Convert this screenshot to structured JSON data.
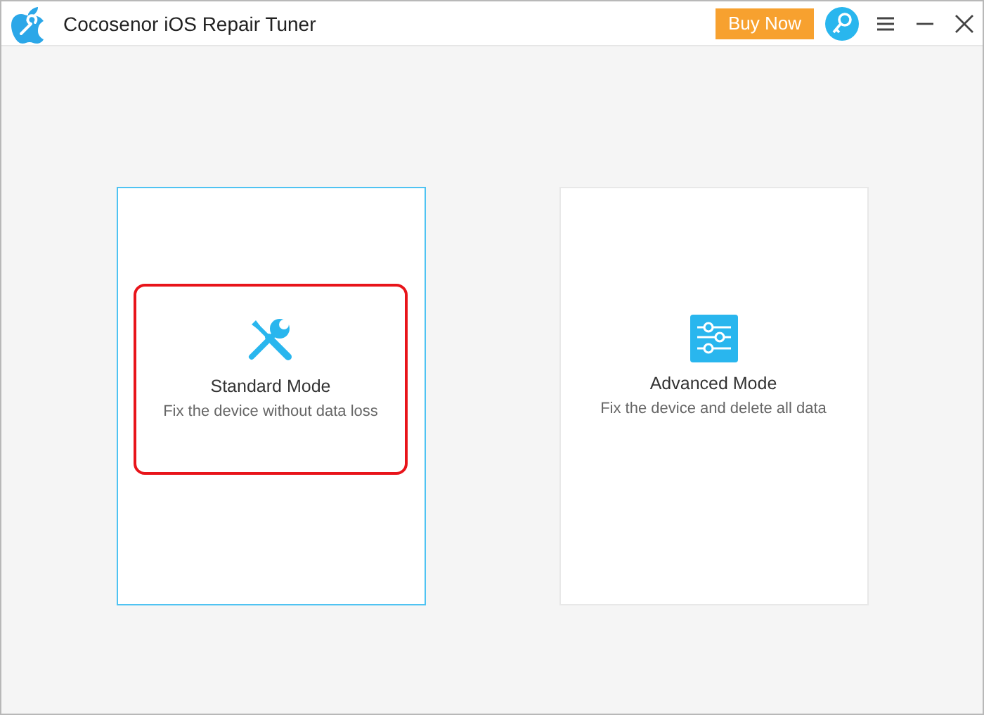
{
  "window": {
    "title": "Cocosenor iOS Repair Tuner",
    "buy_button": "Buy Now"
  },
  "modes": [
    {
      "kind": "standard",
      "title": "Standard Mode",
      "description": "Fix the device without data loss",
      "selected": true,
      "highlighted": true
    },
    {
      "kind": "advanced",
      "title": "Advanced Mode",
      "description": "Fix the device and delete all data",
      "selected": false,
      "highlighted": false
    }
  ]
}
